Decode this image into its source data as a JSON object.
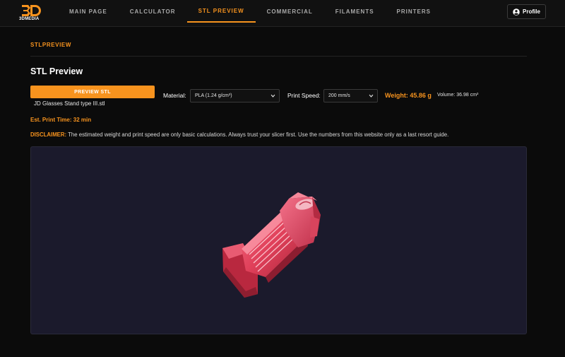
{
  "brand": {
    "logo_text": "3DMEDIA",
    "accent_color": "#f7931e"
  },
  "nav": {
    "items": [
      {
        "label": "MAIN PAGE",
        "active": false
      },
      {
        "label": "CALCULATOR",
        "active": false
      },
      {
        "label": "STL PREVIEW",
        "active": true
      },
      {
        "label": "COMMERCIAL",
        "active": false
      },
      {
        "label": "FILAMENTS",
        "active": false
      },
      {
        "label": "PRINTERS",
        "active": false
      }
    ],
    "profile_label": "Profile",
    "profile_icon": "user-circle-icon"
  },
  "page": {
    "section_label": "STLPREVIEW",
    "title": "STL Preview"
  },
  "controls": {
    "preview_button_label": "PREVIEW STL",
    "file_name": "JD Glasses Stand type III.stl",
    "material_label": "Material:",
    "material_value": "PLA (1.24 g/cm³)",
    "print_speed_label": "Print Speed:",
    "print_speed_value": "200 mm/s",
    "weight_text": "Weight: 45.86 g",
    "volume_text": "Volume: 36.98 cm³"
  },
  "results": {
    "print_time_text": "Est. Print Time: 32 min"
  },
  "disclaimer": {
    "tag": "DISCLAIMER:",
    "text": " The estimated weight and print speed are only basic calculations. Always trust your slicer first. Use the numbers from this website only as a last resort guide."
  },
  "viewer": {
    "background_color": "#1b1a2c",
    "model_color": "#e8475f"
  }
}
